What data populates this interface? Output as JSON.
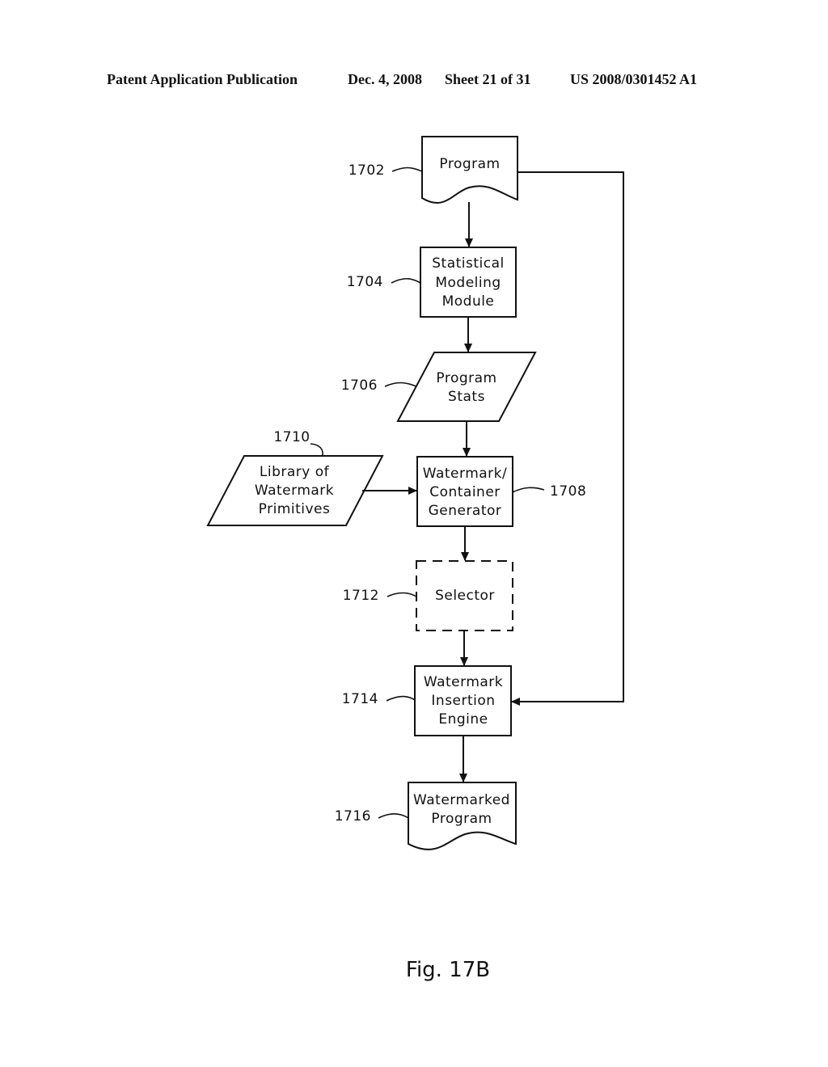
{
  "header": {
    "publication": "Patent Application Publication",
    "date": "Dec. 4, 2008",
    "sheet": "Sheet 21 of 31",
    "number": "US 2008/0301452 A1"
  },
  "figure_label": "Fig. 17B",
  "nodes": {
    "program": {
      "ref": "1702",
      "lines": [
        "Program"
      ],
      "shape": "document"
    },
    "statistical_modeling": {
      "ref": "1704",
      "lines": [
        "Statistical",
        "Modeling",
        "Module"
      ],
      "shape": "process"
    },
    "program_stats": {
      "ref": "1706",
      "lines": [
        "Program",
        "Stats"
      ],
      "shape": "data"
    },
    "watermark_container_generator": {
      "ref": "1708",
      "lines": [
        "Watermark/",
        "Container",
        "Generator"
      ],
      "shape": "process"
    },
    "library": {
      "ref": "1710",
      "lines": [
        "Library of",
        "Watermark",
        "Primitives"
      ],
      "shape": "data"
    },
    "selector": {
      "ref": "1712",
      "lines": [
        "Selector"
      ],
      "shape": "optional-process"
    },
    "insertion_engine": {
      "ref": "1714",
      "lines": [
        "Watermark",
        "Insertion",
        "Engine"
      ],
      "shape": "process"
    },
    "watermarked_program": {
      "ref": "1716",
      "lines": [
        "Watermarked",
        "Program"
      ],
      "shape": "document"
    }
  },
  "edges": [
    [
      "program",
      "statistical_modeling"
    ],
    [
      "statistical_modeling",
      "program_stats"
    ],
    [
      "program_stats",
      "watermark_container_generator"
    ],
    [
      "library",
      "watermark_container_generator"
    ],
    [
      "watermark_container_generator",
      "selector"
    ],
    [
      "selector",
      "insertion_engine"
    ],
    [
      "program",
      "insertion_engine"
    ],
    [
      "insertion_engine",
      "watermarked_program"
    ]
  ]
}
